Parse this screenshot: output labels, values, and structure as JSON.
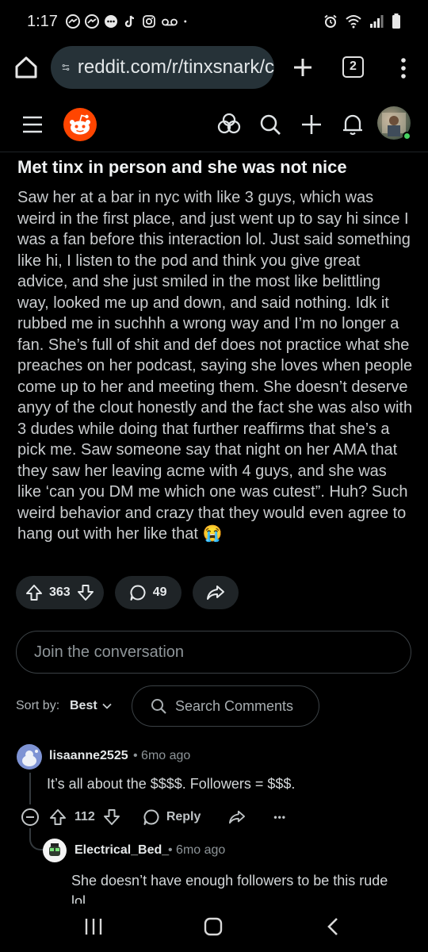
{
  "status_bar": {
    "time": "1:17",
    "left_icons": [
      "messenger-icon",
      "messenger-icon",
      "chat-bubble-icon",
      "tiktok-icon",
      "instagram-icon",
      "voicemail-icon",
      "dot-icon"
    ],
    "right_icons": [
      "alarm-icon",
      "wifi-icon",
      "signal-icon",
      "battery-icon"
    ]
  },
  "browser": {
    "url": "reddit.com/r/tinxsnark/c",
    "tab_count": "2"
  },
  "post": {
    "title": "Met tinx in person and she was not nice",
    "body": "Saw her at a bar in nyc with like 3 guys, which was weird in the first place, and just went up to say hi since I was a fan before this interaction lol. Just said something like hi, I listen to the pod and think you give great advice, and she just smiled in the most like belittling way, looked me up and down, and said nothing. Idk it rubbed me in suchhh a wrong way and I’m no longer a fan. She’s full of shit and def does not practice what she preaches on her podcast, saying she loves when people come up to her and meeting them. She doesn’t deserve anyy of the clout honestly and the fact she was also with 3 dudes while doing that further reaffirms that she’s a pick me. Saw someone say that night on her AMA that they saw her leaving acme with 4 guys, and she was like ‘can you DM me which one was cutest”. Huh? Such weird behavior and crazy that they would even agree to hang out with her like that 😭",
    "votes": "363",
    "comments": "49"
  },
  "join": {
    "placeholder": "Join the conversation"
  },
  "sort": {
    "label": "Sort by:",
    "value": "Best",
    "search_placeholder": "Search Comments"
  },
  "comments": [
    {
      "user": "lisaanne2525",
      "meta": "• 6mo ago",
      "text": "It’s all about the $$$$. Followers = $$$.",
      "votes": "112",
      "reply_label": "Reply",
      "more": "•••"
    },
    {
      "user": "Electrical_Bed_",
      "meta": "• 6mo ago",
      "text": "She doesn’t have enough followers to be this rude lol"
    }
  ],
  "colors": {
    "background": "#000000",
    "reddit_orange": "#ff4500",
    "url_bar": "#263238",
    "pill": "#1f2427",
    "online_dot": "#46d160"
  }
}
